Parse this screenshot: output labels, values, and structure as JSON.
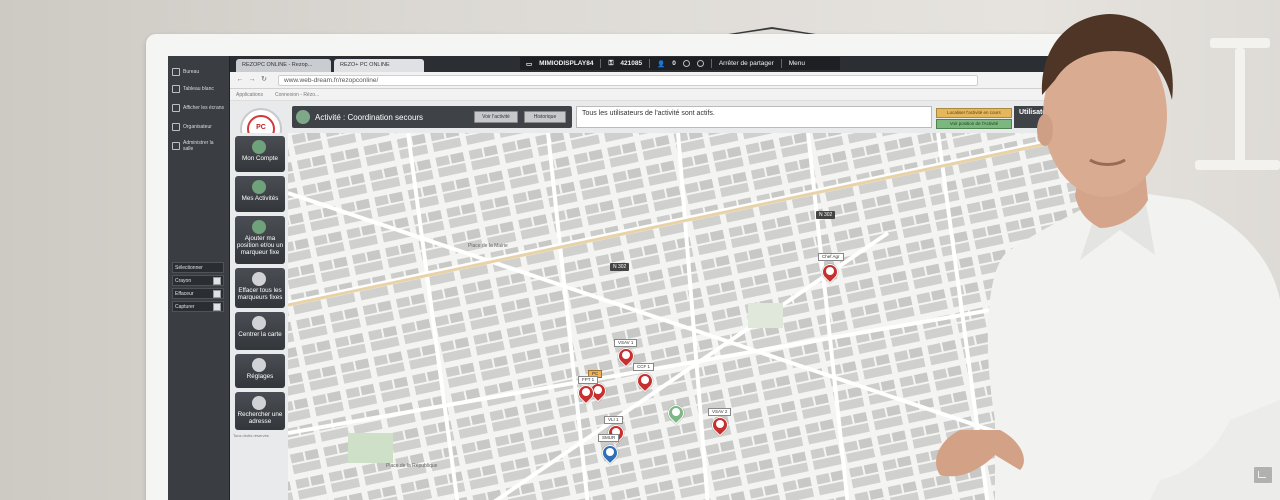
{
  "whiteboard_panel": {
    "items": [
      "Bureau",
      "Tableau blanc",
      "Afficher les écrans",
      "Organisateur",
      "Administrer la salle"
    ],
    "tools": [
      "Sélectionner",
      "Crayon",
      "Effaceur",
      "Capturer"
    ]
  },
  "browser": {
    "tabs": [
      "REZOPC ONLINE - Rezop...",
      "REZO+ PC ONLINE"
    ],
    "url": "www.web-dream.fr/rezopconline/",
    "bookmarks": [
      "Applications",
      "Connexion - Rézo..."
    ]
  },
  "share_bar": {
    "device": "MIMIODISPLAY84",
    "code": "421085",
    "participants": "0",
    "stop_label": "Arrêter de partager",
    "menu_label": "Menu"
  },
  "app": {
    "logo_text": "PC",
    "activity_title": "Activité : Coordination secours",
    "activity_btn_1": "Voir l'activité",
    "activity_btn_2": "Historique",
    "users_message": "Tous les utilisateurs de l'activité sont actifs.",
    "btn_yellow": "Localiser l'activité en cours",
    "btn_green": "Voir position de l'Activité",
    "users_heading": "Utilisateurs",
    "sidebar": [
      {
        "label": "Mon Compte",
        "icon": "user-icon"
      },
      {
        "label": "Mes Activités",
        "icon": "group-icon"
      },
      {
        "label": "Ajouter ma position et/ou un marqueur fixe",
        "icon": "location-icon"
      },
      {
        "label": "Effacer tous les marqueurs fixes",
        "icon": "close-icon"
      },
      {
        "label": "Centrer la carte",
        "icon": "move-icon"
      },
      {
        "label": "Réglages",
        "icon": "search-settings-icon"
      },
      {
        "label": "Rechercher une adresse",
        "icon": "search-icon"
      }
    ],
    "sidebar_footer": "Tous droits réservés"
  },
  "map": {
    "road_badges": [
      "N 302",
      "N 302"
    ],
    "street_labels": [
      "Place de la Mairie",
      "Place de la République"
    ],
    "pins": [
      {
        "label": "Chef Agr",
        "type": "truck",
        "color": "#c8302f"
      },
      {
        "label": "VSAV 1",
        "type": "truck",
        "color": "#c8302f"
      },
      {
        "label": "PC",
        "type": "command",
        "color": "#c8302f"
      },
      {
        "label": "FPT 1",
        "type": "fire",
        "color": "#c8302f"
      },
      {
        "label": "CCF 1",
        "type": "fire",
        "color": "#c8302f"
      },
      {
        "label": "",
        "type": "marker",
        "color": "#7cb883"
      },
      {
        "label": "VSAV 2",
        "type": "truck",
        "color": "#c8302f"
      },
      {
        "label": "VLI 1",
        "type": "truck",
        "color": "#c8302f"
      },
      {
        "label": "SMUR",
        "type": "medical",
        "color": "#2e6fb7"
      }
    ]
  },
  "colors": {
    "accent_dark": "#3f4348",
    "alert_red": "#c8302f",
    "status_green": "#7cb883",
    "status_yellow": "#e5b75c"
  }
}
